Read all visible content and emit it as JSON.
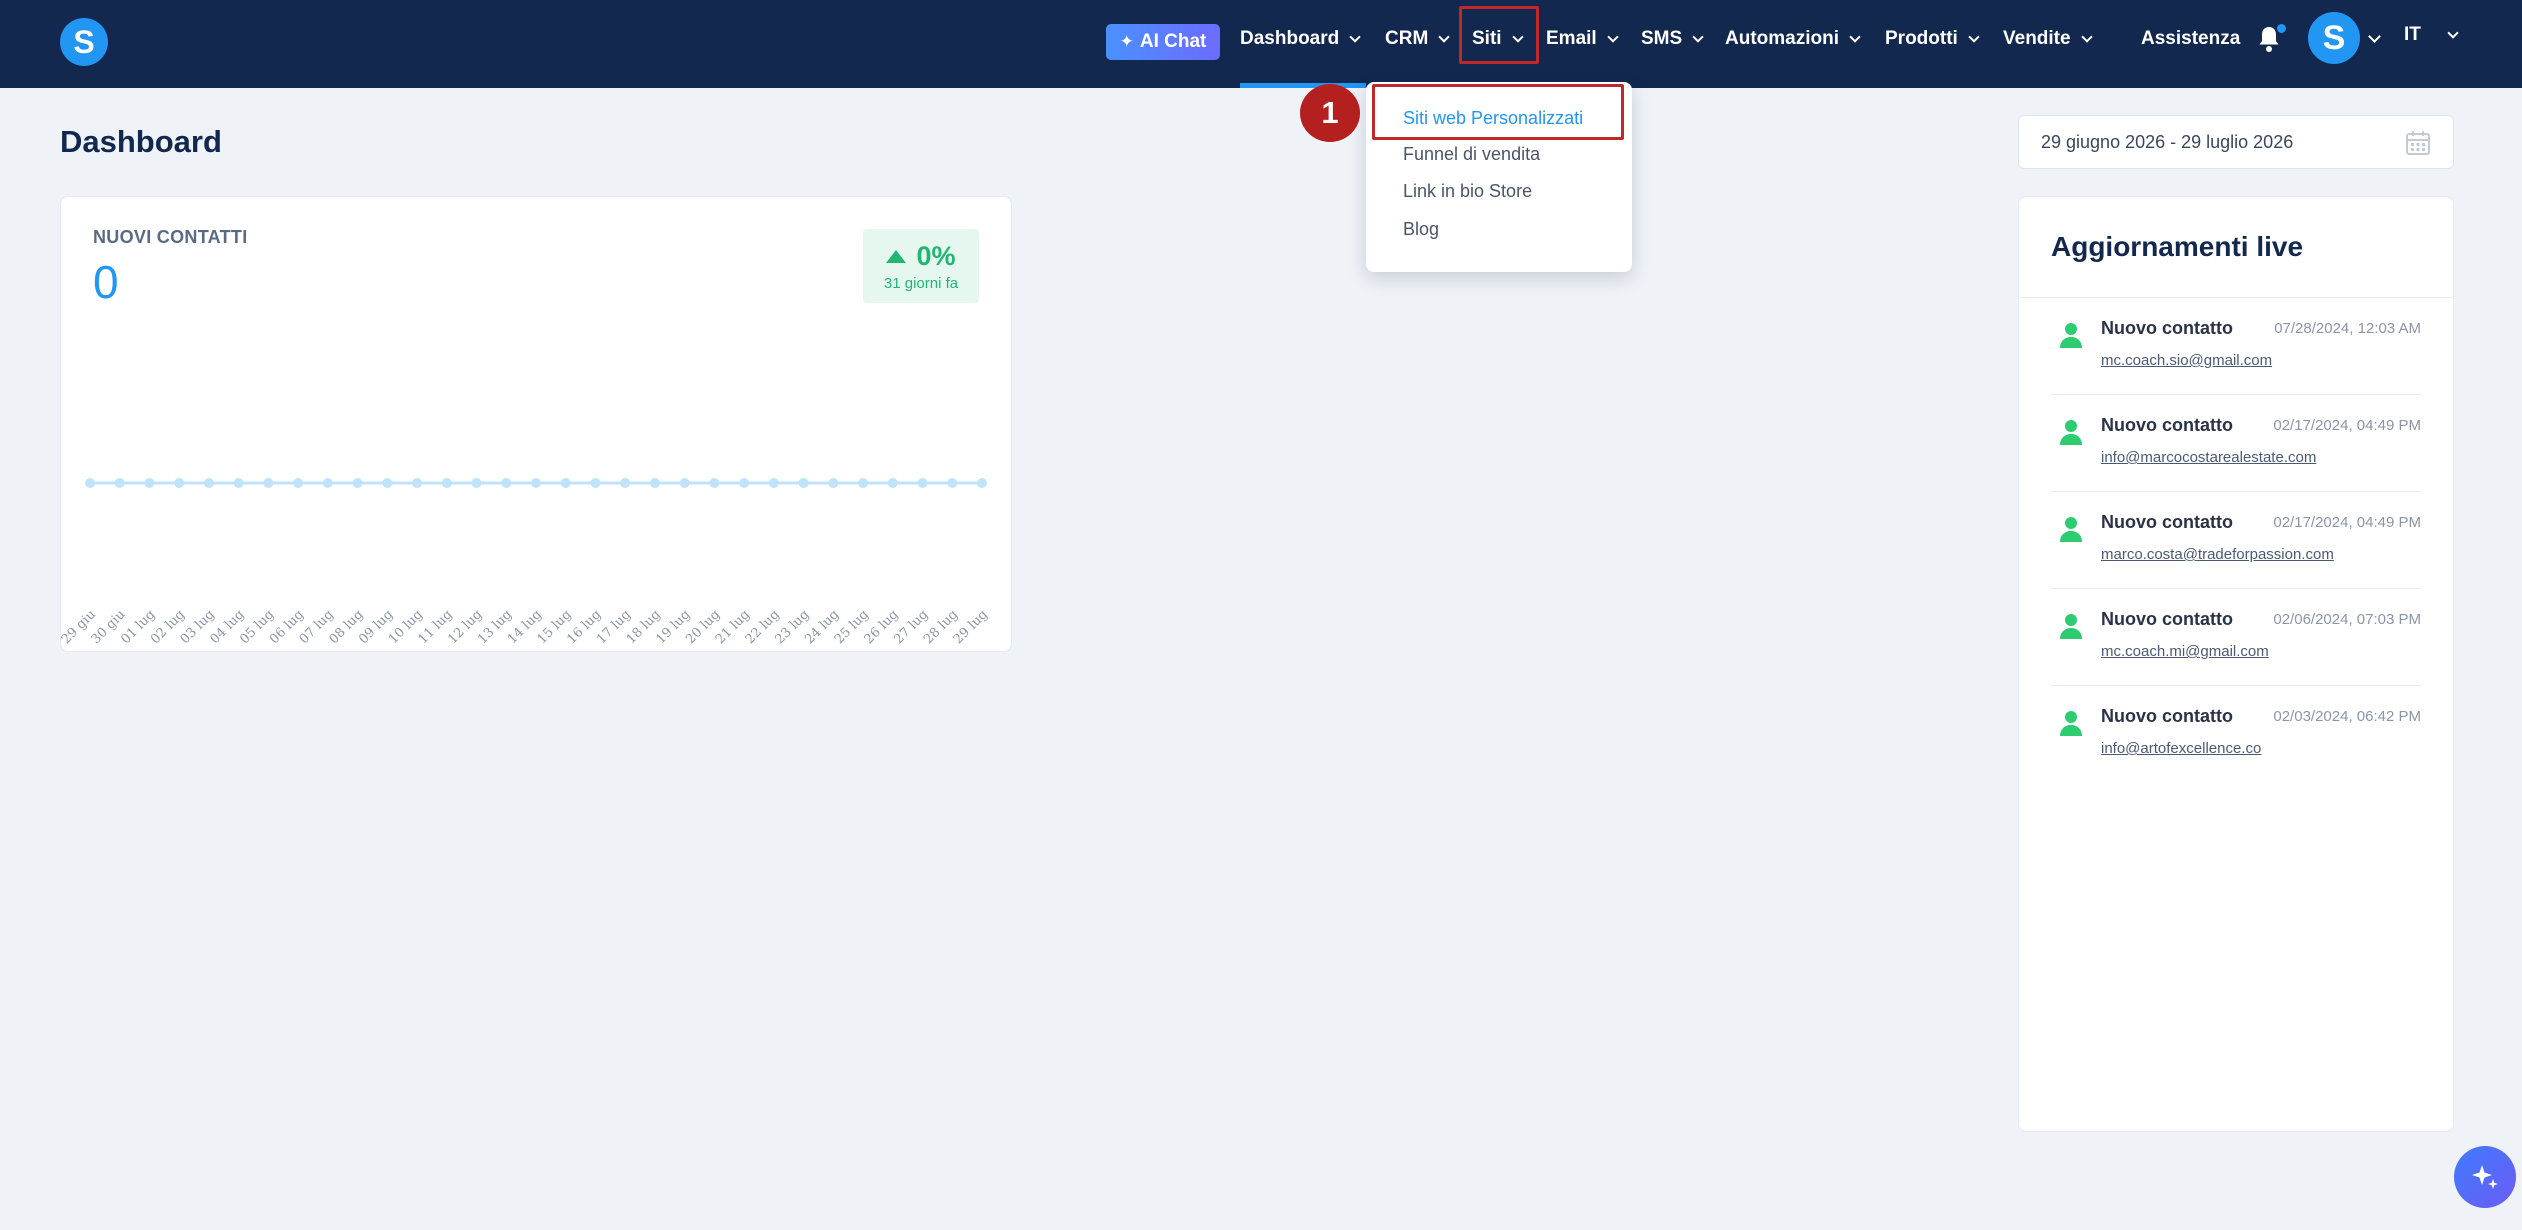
{
  "topbar": {
    "logo_letter": "S",
    "ai_chat_label": "AI Chat",
    "nav": [
      {
        "label": "Dashboard"
      },
      {
        "label": "CRM"
      },
      {
        "label": "Siti"
      },
      {
        "label": "Email"
      },
      {
        "label": "SMS"
      },
      {
        "label": "Automazioni"
      },
      {
        "label": "Prodotti"
      },
      {
        "label": "Vendite"
      }
    ],
    "assistenza": "Assistenza",
    "avatar_letter": "S",
    "language": "IT",
    "icons": [
      "sparkle-icon",
      "chevron-down-icon",
      "bell-icon"
    ],
    "colors": {
      "background": "#13284f",
      "accent": "#2196f3"
    }
  },
  "page": {
    "title": "Dashboard",
    "date_range": "29 giugno 2026 - 29 luglio 2026"
  },
  "contacts_card": {
    "label": "NUOVI CONTATTI",
    "value": "0",
    "change": "0%",
    "change_sub": "31 giorni fa"
  },
  "chart_data": {
    "type": "line",
    "x": [
      "29 giu",
      "30 giu",
      "01 lug",
      "02 lug",
      "03 lug",
      "04 lug",
      "05 lug",
      "06 lug",
      "07 lug",
      "08 lug",
      "09 lug",
      "10 lug",
      "11 lug",
      "12 lug",
      "13 lug",
      "14 lug",
      "15 lug",
      "16 lug",
      "17 lug",
      "18 lug",
      "19 lug",
      "20 lug",
      "21 lug",
      "22 lug",
      "23 lug",
      "24 lug",
      "25 lug",
      "26 lug",
      "27 lug",
      "28 lug",
      "29 lug"
    ],
    "series": [
      {
        "values": [
          0,
          0,
          0,
          0,
          0,
          0,
          0,
          0,
          0,
          0,
          0,
          0,
          0,
          0,
          0,
          0,
          0,
          0,
          0,
          0,
          0,
          0,
          0,
          0,
          0,
          0,
          0,
          0,
          0,
          0,
          0
        ]
      }
    ],
    "title": "",
    "xlabel": "",
    "ylabel": "",
    "grid": false,
    "color": "#bfe3fb"
  },
  "dropdown": {
    "step_number": "1",
    "items": [
      {
        "label": "Siti web Personalizzati"
      },
      {
        "label": "Funnel di vendita"
      },
      {
        "label": "Link in bio Store"
      },
      {
        "label": "Blog"
      }
    ]
  },
  "live": {
    "title": "Aggiornamenti live",
    "items": [
      {
        "name": "Nuovo contatto",
        "time": "07/28/2024, 12:03 AM",
        "email": "mc.coach.sio@gmail.com"
      },
      {
        "name": "Nuovo contatto",
        "time": "02/17/2024, 04:49 PM",
        "email": "info@marcocostarealestate.com"
      },
      {
        "name": "Nuovo contatto",
        "time": "02/17/2024, 04:49 PM",
        "email": "marco.costa@tradeforpassion.com"
      },
      {
        "name": "Nuovo contatto",
        "time": "02/06/2024, 07:03 PM",
        "email": "mc.coach.mi@gmail.com"
      },
      {
        "name": "Nuovo contatto",
        "time": "02/03/2024, 06:42 PM",
        "email": "info@artofexcellence.co"
      }
    ]
  }
}
